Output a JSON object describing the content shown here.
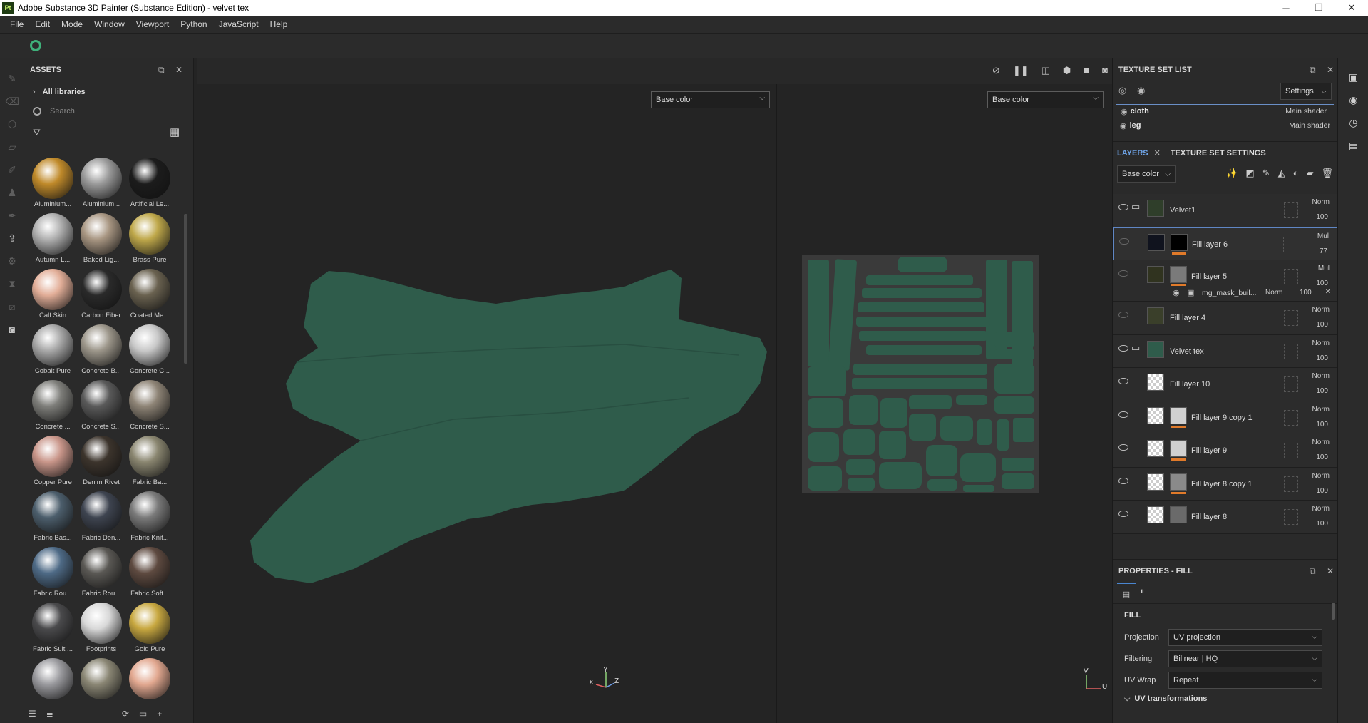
{
  "window": {
    "title": "Adobe Substance 3D Painter (Substance Edition) - velvet tex",
    "app_icon": "Pt",
    "controls": [
      "─",
      "❐",
      "✕"
    ]
  },
  "menu": [
    "File",
    "Edit",
    "Mode",
    "Window",
    "Viewport",
    "Python",
    "JavaScript",
    "Help"
  ],
  "assets": {
    "title": "ASSETS",
    "library": "All libraries",
    "search_placeholder": "Search",
    "materials": [
      {
        "label": "Aluminium...",
        "color": "#c08a2a"
      },
      {
        "label": "Aluminium...",
        "color": "#9a9a9a"
      },
      {
        "label": "Artificial Le...",
        "color": "#1c1c1c"
      },
      {
        "label": "Autumn L...",
        "color": "#b0b0b0"
      },
      {
        "label": "Baked Lig...",
        "color": "#a89682"
      },
      {
        "label": "Brass Pure",
        "color": "#bfa84a"
      },
      {
        "label": "Calf Skin",
        "color": "#e2ae98"
      },
      {
        "label": "Carbon Fiber",
        "color": "#2a2a2a"
      },
      {
        "label": "Coated Me...",
        "color": "#6a6250"
      },
      {
        "label": "Cobalt Pure",
        "color": "#a8a8a8"
      },
      {
        "label": "Concrete B...",
        "color": "#9c968a"
      },
      {
        "label": "Concrete C...",
        "color": "#c8c8c8"
      },
      {
        "label": "Concrete ...",
        "color": "#7e7e7a"
      },
      {
        "label": "Concrete S...",
        "color": "#5a5a5a"
      },
      {
        "label": "Concrete S...",
        "color": "#8e8476"
      },
      {
        "label": "Copper Pure",
        "color": "#c9968a"
      },
      {
        "label": "Denim Rivet",
        "color": "#3c342c"
      },
      {
        "label": "Fabric Ba...",
        "color": "#8a8670"
      },
      {
        "label": "Fabric Bas...",
        "color": "#4c5e6c"
      },
      {
        "label": "Fabric Den...",
        "color": "#3e4450"
      },
      {
        "label": "Fabric Knit...",
        "color": "#7a7a7a"
      },
      {
        "label": "Fabric Rou...",
        "color": "#4e6a86"
      },
      {
        "label": "Fabric Rou...",
        "color": "#5a5854"
      },
      {
        "label": "Fabric Soft...",
        "color": "#5e4a40"
      },
      {
        "label": "Fabric Suit ...",
        "color": "#4a4a4c"
      },
      {
        "label": "Footprints",
        "color": "#d8d8d8"
      },
      {
        "label": "Gold Pure",
        "color": "#c8a840"
      },
      {
        "label": "",
        "color": "#9a9a9e"
      },
      {
        "label": "",
        "color": "#8a8674"
      },
      {
        "label": "",
        "color": "#e2a890"
      }
    ]
  },
  "viewport": {
    "left_channel": "Base color",
    "right_channel": "Base color",
    "mesh_color": "#2f5c4b",
    "uv_bg": "#3a3a3a",
    "axis_3d": [
      "Y",
      "X",
      "Z"
    ],
    "axis_2d": [
      "V",
      "U"
    ]
  },
  "texture_set_list": {
    "title": "TEXTURE SET LIST",
    "settings_label": "Settings",
    "sets": [
      {
        "name": "cloth",
        "shader": "Main shader"
      },
      {
        "name": "leg",
        "shader": "Main shader"
      }
    ]
  },
  "layers_panel": {
    "tab_layers": "LAYERS",
    "tab_tss": "TEXTURE SET SETTINGS",
    "channel": "Base color",
    "layers": [
      {
        "name": "Velvet1",
        "blend": "Norm",
        "opacity": "100",
        "type": "folder"
      },
      {
        "name": "Fill layer 6",
        "blend": "Mul",
        "opacity": "77",
        "type": "fill"
      },
      {
        "name": "Fill layer 5",
        "blend": "Mul",
        "opacity": "100",
        "type": "fill"
      },
      {
        "name": "mg_mask_buil...",
        "blend": "Norm",
        "opacity": "100",
        "type": "effect"
      },
      {
        "name": "Fill layer 4",
        "blend": "Norm",
        "opacity": "100",
        "type": "fill"
      },
      {
        "name": "Velvet tex",
        "blend": "Norm",
        "opacity": "100",
        "type": "folder"
      },
      {
        "name": "Fill layer 10",
        "blend": "Norm",
        "opacity": "100",
        "type": "fill"
      },
      {
        "name": "Fill layer 9 copy 1",
        "blend": "Norm",
        "opacity": "100",
        "type": "fill"
      },
      {
        "name": "Fill layer 9",
        "blend": "Norm",
        "opacity": "100",
        "type": "fill"
      },
      {
        "name": "Fill layer 8 copy 1",
        "blend": "Norm",
        "opacity": "100",
        "type": "fill"
      },
      {
        "name": "Fill layer 8",
        "blend": "Norm",
        "opacity": "100",
        "type": "fill"
      }
    ]
  },
  "properties": {
    "title": "PROPERTIES - FILL",
    "section": "FILL",
    "projection_label": "Projection",
    "projection_value": "UV projection",
    "filtering_label": "Filtering",
    "filtering_value": "Bilinear | HQ",
    "uvwrap_label": "UV Wrap",
    "uvwrap_value": "Repeat",
    "uv_transformations": "UV transformations"
  }
}
